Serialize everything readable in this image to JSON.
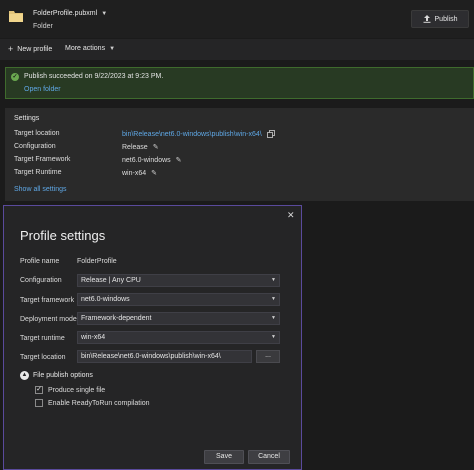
{
  "header": {
    "profile_name": "FolderProfile.pubxml",
    "profile_kind": "Folder",
    "publish_label": "Publish"
  },
  "toolbar": {
    "new_profile": "New profile",
    "more_actions": "More actions"
  },
  "banner": {
    "message": "Publish succeeded on 9/22/2023 at 9:23 PM.",
    "open_folder": "Open folder"
  },
  "settings": {
    "title": "Settings",
    "rows": [
      {
        "label": "Target location",
        "value": "bin\\Release\\net6.0-windows\\publish\\win-x64\\"
      },
      {
        "label": "Configuration",
        "value": "Release"
      },
      {
        "label": "Target Framework",
        "value": "net6.0-windows"
      },
      {
        "label": "Target Runtime",
        "value": "win-x64"
      }
    ],
    "show_all": "Show all settings"
  },
  "dialog": {
    "title": "Profile settings",
    "profile_name_label": "Profile name",
    "profile_name_value": "FolderProfile",
    "configuration_label": "Configuration",
    "configuration_value": "Release | Any CPU",
    "framework_label": "Target framework",
    "framework_value": "net6.0-windows",
    "deployment_label": "Deployment mode",
    "deployment_value": "Framework-dependent",
    "runtime_label": "Target runtime",
    "runtime_value": "win-x64",
    "location_label": "Target location",
    "location_value": "bin\\Release\\net6.0-windows\\publish\\win-x64\\",
    "browse_label": "...",
    "section_label": "File publish options",
    "option_single_file": "Produce single file",
    "option_single_file_checked": true,
    "option_ready_to_run": "Enable ReadyToRun compilation",
    "option_ready_to_run_checked": false,
    "save_label": "Save",
    "cancel_label": "Cancel"
  },
  "colors": {
    "accent_link": "#5fa8e6",
    "success_border": "#3f6b2d",
    "success_check": "#6aa84f",
    "dialog_border": "#5a4a9c"
  }
}
